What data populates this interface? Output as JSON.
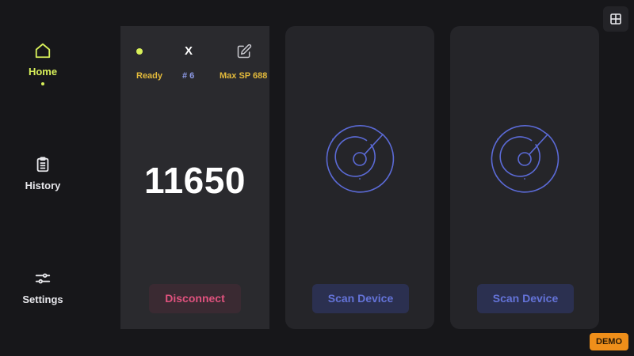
{
  "sidebar": {
    "items": [
      {
        "label": "Home",
        "icon": "home-icon",
        "active": true
      },
      {
        "label": "History",
        "icon": "clipboard-icon",
        "active": false
      },
      {
        "label": "Settings",
        "icon": "sliders-icon",
        "active": false
      }
    ]
  },
  "toolbar": {
    "grid_icon": "grid-icon"
  },
  "devices": [
    {
      "state": "connected",
      "close_label": "X",
      "status": "Ready",
      "device_number": "# 6",
      "max_sp": "Max SP 688",
      "value": "11650",
      "button_label": "Disconnect"
    },
    {
      "state": "empty",
      "button_label": "Scan Device",
      "icon": "radar-icon"
    },
    {
      "state": "empty",
      "button_label": "Scan Device",
      "icon": "radar-icon"
    }
  ],
  "badge": {
    "label": "DEMO"
  },
  "colors": {
    "accent": "#d8f05a",
    "status_text": "#e2b93b",
    "device_number": "#8e9be8",
    "disconnect": "#e0527e",
    "scan": "#6473d8",
    "demo_badge": "#ef8f1a",
    "background": "#17171a"
  }
}
